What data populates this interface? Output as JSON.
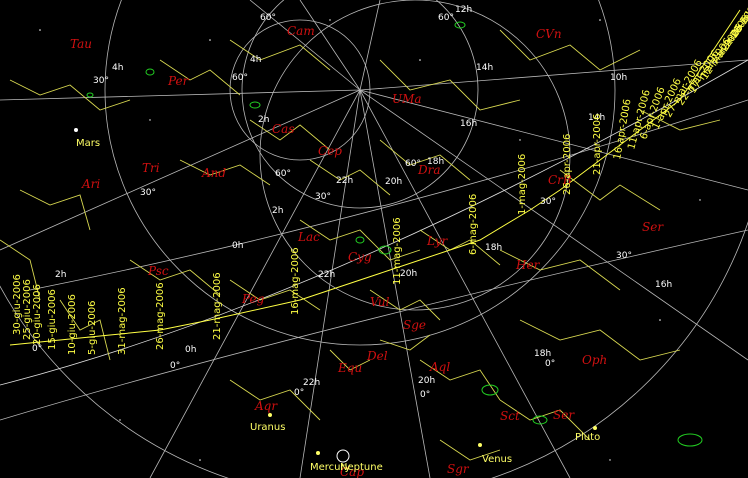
{
  "chart": {
    "constellations": [
      "Tau",
      "Per",
      "Cam",
      "CVn",
      "UMa",
      "Cas",
      "Cep",
      "And",
      "Tri",
      "Ari",
      "Dra",
      "CrB",
      "Lac",
      "Cyg",
      "Lyr",
      "Her",
      "Ser",
      "Psc",
      "Peg",
      "Vul",
      "Sge",
      "Del",
      "Equ",
      "Aql",
      "Oph",
      "Aqr",
      "Sct",
      "Ser",
      "Sgr",
      "Cap"
    ],
    "ra_labels": [
      "4h",
      "2h",
      "0h",
      "22h",
      "20h",
      "18h",
      "16h",
      "14h",
      "12h",
      "10h",
      "2h",
      "4h",
      "20h",
      "18h",
      "22h",
      "0h",
      "2h",
      "14h",
      "22h",
      "20h",
      "18h",
      "16h"
    ],
    "dec_labels": [
      "60°",
      "30°",
      "60°",
      "60°",
      "30°",
      "30°",
      "60°",
      "30°",
      "0°",
      "0°",
      "0°",
      "0°",
      "0°",
      "60°",
      "30°"
    ],
    "planets": [
      "Mars",
      "Uranus",
      "Mercury",
      "Neptune",
      "Venus",
      "Pluto"
    ],
    "comet_dates": [
      "30-giu-2006",
      "25-giu-2006",
      "20-giu-2006",
      "15-giu-2006",
      "10-giu-2006",
      "5-giu-2006",
      "31-mag-2006",
      "26-mag-2006",
      "21-mag-2006",
      "16-mag-2006",
      "11-mag-2006",
      "6-mag-2006",
      "1-mag-2006",
      "26-apr-2006",
      "21-apr-2006",
      "16-apr-2006",
      "11-apr-2006",
      "6-apr-2006",
      "1-apr-2006",
      "27-mar-2006",
      "22-mar-2006",
      "17-mar-2006",
      "12-mar-2006",
      "7-mar-2006",
      "2-mar-2006",
      "25-feb-2006"
    ],
    "colors": {
      "background": "#000000",
      "grid": "#b8b8b8",
      "constellation_lines": "#d8d850",
      "constellation_names": "#d01010",
      "nebulae": "#22cc22",
      "comet": "#ffff44"
    }
  }
}
